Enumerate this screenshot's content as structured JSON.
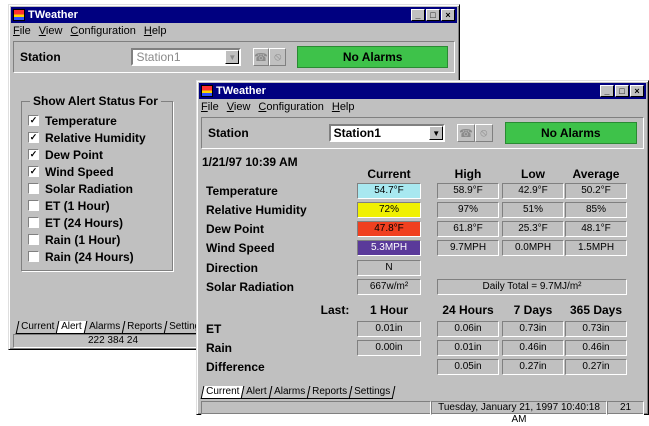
{
  "back_window": {
    "title": "TWeather",
    "menu": [
      "File",
      "View",
      "Configuration",
      "Help"
    ],
    "station_label": "Station",
    "station_value": "Station1",
    "alarm_text": "No Alarms",
    "alert_group_title": "Show Alert Status For",
    "alerts": [
      {
        "label": "Temperature",
        "checked": true
      },
      {
        "label": "Relative Humidity",
        "checked": true
      },
      {
        "label": "Dew Point",
        "checked": true
      },
      {
        "label": "Wind Speed",
        "checked": true
      },
      {
        "label": "Solar Radiation",
        "checked": false
      },
      {
        "label": "ET (1 Hour)",
        "checked": false
      },
      {
        "label": "ET (24 Hours)",
        "checked": false
      },
      {
        "label": "Rain (1 Hour)",
        "checked": false
      },
      {
        "label": "Rain (24 Hours)",
        "checked": false
      }
    ],
    "tabs": [
      "Current",
      "Alert",
      "Alarms",
      "Reports",
      "Settings"
    ],
    "active_tab": "Alert",
    "status": "222 384 24"
  },
  "front_window": {
    "title": "TWeather",
    "menu": [
      "File",
      "View",
      "Configuration",
      "Help"
    ],
    "station_label": "Station",
    "station_value": "Station1",
    "alarm_text": "No Alarms",
    "datetime": "1/21/97 10:39 AM",
    "columns": [
      "Current",
      "High",
      "Low",
      "Average"
    ],
    "rows": [
      {
        "label": "Temperature",
        "current": "54.7°F",
        "high": "58.9°F",
        "low": "42.9°F",
        "average": "50.2°F",
        "color": "#a8e8f0"
      },
      {
        "label": "Relative Humidity",
        "current": "72%",
        "high": "97%",
        "low": "51%",
        "average": "85%",
        "color": "#f0f000"
      },
      {
        "label": "Dew Point",
        "current": "47.8°F",
        "high": "61.8°F",
        "low": "25.3°F",
        "average": "48.1°F",
        "color": "#f04020"
      },
      {
        "label": "Wind Speed",
        "current": "5.3MPH",
        "high": "9.7MPH",
        "low": "0.0MPH",
        "average": "1.5MPH",
        "color": "#5a3a9a"
      }
    ],
    "direction": {
      "label": "Direction",
      "value": "N"
    },
    "solar": {
      "label": "Solar Radiation",
      "value": "667w/m²",
      "daily": "Daily Total = 9.7MJ/m²"
    },
    "last_label": "Last:",
    "period_columns": [
      "1 Hour",
      "24 Hours",
      "7 Days",
      "365 Days"
    ],
    "period_rows": [
      {
        "label": "ET",
        "values": [
          "0.01in",
          "0.06in",
          "0.73in",
          "0.73in"
        ]
      },
      {
        "label": "Rain",
        "values": [
          "0.00in",
          "0.01in",
          "0.46in",
          "0.46in"
        ]
      },
      {
        "label": "Difference",
        "values": [
          "",
          "0.05in",
          "0.27in",
          "0.27in"
        ]
      }
    ],
    "tabs": [
      "Current",
      "Alert",
      "Alarms",
      "Reports",
      "Settings"
    ],
    "active_tab": "Current",
    "status_datetime": "Tuesday, January 21, 1997 10:40:18 AM",
    "status_num": "21"
  }
}
